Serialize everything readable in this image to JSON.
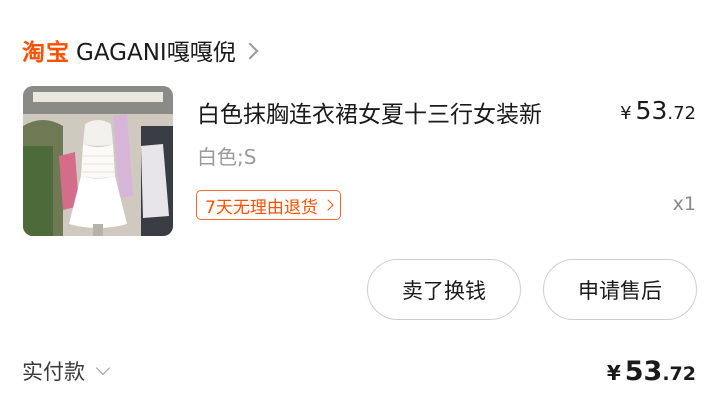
{
  "shop": {
    "platform": "淘宝",
    "name": "GAGANI嘎嘎倪",
    "chevron_icon": "chevron-right-icon"
  },
  "item": {
    "image_icon": "product-photo-white-dress",
    "title": "白色抹胸连衣裙女夏十三行女装新",
    "price": {
      "currency": "¥",
      "integer": "53",
      "decimal": ".72"
    },
    "sku": "白色;S",
    "badge": "7天无理由退货",
    "quantity": "x1"
  },
  "actions": {
    "sell_label": "卖了换钱",
    "service_label": "申请售后"
  },
  "footer": {
    "label": "实付款",
    "total": {
      "currency": "¥",
      "integer": "53",
      "decimal": ".72"
    }
  },
  "colors": {
    "brand": "#ff5000",
    "muted": "#9a9a9a",
    "border": "#cfcfcf"
  }
}
